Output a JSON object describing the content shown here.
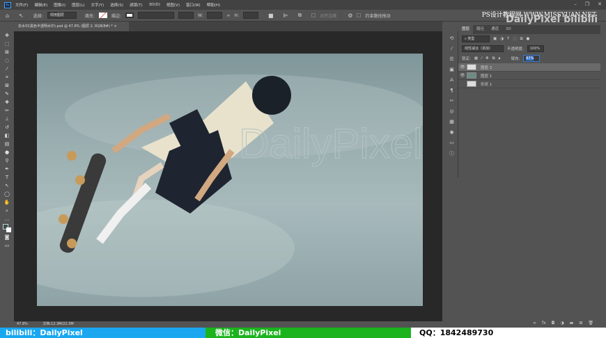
{
  "app": {
    "logo": "Ps"
  },
  "menu": [
    "文件(F)",
    "编辑(E)",
    "图像(I)",
    "图层(L)",
    "文字(Y)",
    "选择(S)",
    "滤镜(T)",
    "3D(D)",
    "视图(V)",
    "窗口(W)",
    "帮助(H)"
  ],
  "options": {
    "select_label": "选择:",
    "select_value": "现用图层",
    "fill_label": "填充:",
    "stroke_label": "描边:",
    "w_label": "W:",
    "h_label": "H:",
    "align_edges": "对齐边缘",
    "constrain_label": "约束路径拖动"
  },
  "document_tab": "去水印(黑色半透明水印).psd @ 47.8% (图层 2, RGB/8#) *",
  "tab_close": "×",
  "status": {
    "zoom": "47.8%",
    "doc": "文档:12.3M/22.3M"
  },
  "photo_watermark": "DailyPixel",
  "panel": {
    "tabs": [
      "图层",
      "路径",
      "通道",
      "3D"
    ],
    "filter": "类型",
    "blend_mode": "线性减淡（添加）",
    "opacity_label": "不透明度:",
    "opacity": "100%",
    "lock_label": "锁定:",
    "fill_label": "填充:",
    "fill": "67%",
    "layers": [
      {
        "name": "图层 2",
        "visible": true,
        "selected": true
      },
      {
        "name": "图层 1",
        "visible": true,
        "selected": false
      },
      {
        "name": "形状 1",
        "visible": false,
        "selected": false
      }
    ]
  },
  "watermarks": {
    "site": "PS设计教程网 WWW.MISSYUAN.NET",
    "brand": "DailyPixel bilibili"
  },
  "banner": {
    "bili": "bilibili：DailyPixel",
    "wechat": "微信：DailyPixel",
    "qq": "QQ：1842489730"
  }
}
